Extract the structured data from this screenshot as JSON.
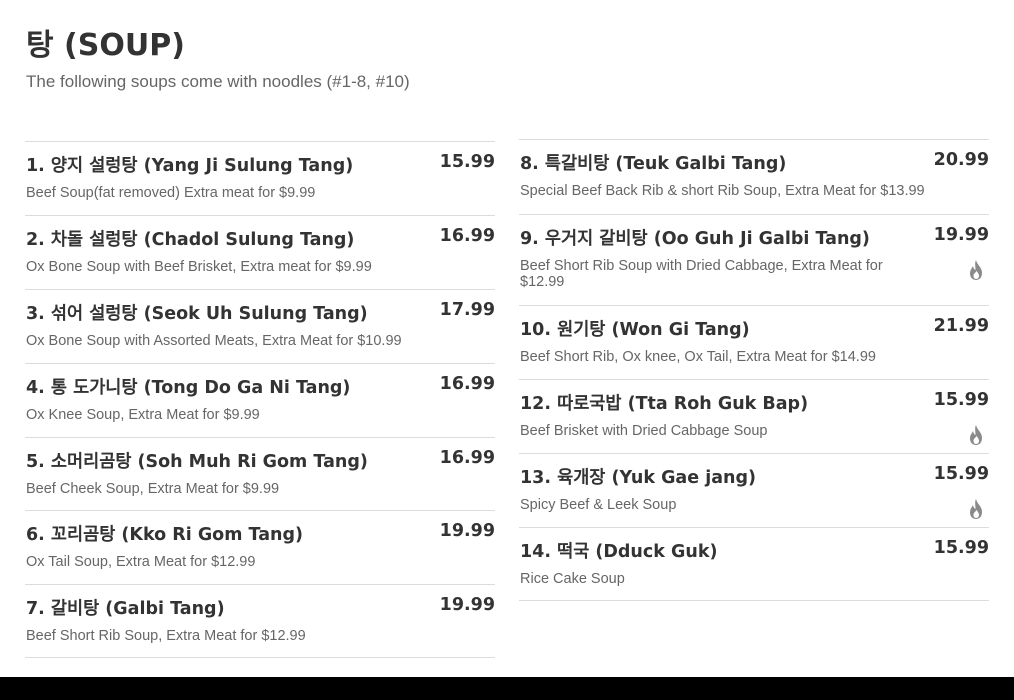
{
  "header": {
    "title": "탕 (SOUP)",
    "subtitle": "The following soups come with noodles (#1-8, #10)"
  },
  "colors": {
    "text": "#333333",
    "muted": "#666666",
    "divider": "#dcdcdc",
    "spicy_icon": "#8a8a8a",
    "bottom_bar": "#000000"
  },
  "left_column": [
    {
      "name": "1. 양지 설렁탕 (Yang Ji Sulung Tang)",
      "price": "15.99",
      "desc": "Beef Soup(fat removed) Extra meat for $9.99",
      "spicy": false
    },
    {
      "name": "2. 차돌 설렁탕 (Chadol Sulung Tang)",
      "price": "16.99",
      "desc": "Ox Bone Soup with Beef Brisket, Extra meat for $9.99",
      "spicy": false
    },
    {
      "name": "3. 섞어 설렁탕 (Seok Uh Sulung Tang)",
      "price": "17.99",
      "desc": "Ox Bone Soup with Assorted Meats, Extra Meat for $10.99",
      "spicy": false
    },
    {
      "name": "4. 통 도가니탕 (Tong Do Ga Ni Tang)",
      "price": "16.99",
      "desc": "Ox Knee Soup, Extra Meat for $9.99",
      "spicy": false
    },
    {
      "name": "5. 소머리곰탕 (Soh Muh Ri Gom Tang)",
      "price": "16.99",
      "desc": "Beef Cheek Soup, Extra Meat for $9.99",
      "spicy": false
    },
    {
      "name": "6. 꼬리곰탕 (Kko Ri Gom Tang)",
      "price": "19.99",
      "desc": "Ox Tail Soup, Extra Meat for $12.99",
      "spicy": false
    },
    {
      "name": "7. 갈비탕 (Galbi Tang)",
      "price": "19.99",
      "desc": "Beef Short Rib Soup, Extra Meat for $12.99",
      "spicy": false
    }
  ],
  "right_column": [
    {
      "name": "8. 특갈비탕 (Teuk Galbi Tang)",
      "price": "20.99",
      "desc": "Special Beef Back Rib & short Rib Soup, Extra Meat for $13.99",
      "spicy": false
    },
    {
      "name": "9. 우거지 갈비탕 (Oo Guh Ji Galbi Tang)",
      "price": "19.99",
      "desc": "Beef Short Rib Soup with Dried Cabbage, Extra Meat for $12.99",
      "spicy": true
    },
    {
      "name": "10. 원기탕 (Won Gi Tang)",
      "price": "21.99",
      "desc": "Beef Short Rib, Ox knee, Ox Tail, Extra Meat for $14.99",
      "spicy": false
    },
    {
      "name": "12. 따로국밥 (Tta Roh Guk Bap)",
      "price": "15.99",
      "desc": "Beef Brisket with Dried Cabbage Soup",
      "spicy": true
    },
    {
      "name": "13. 육개장 (Yuk Gae jang)",
      "price": "15.99",
      "desc": "Spicy Beef & Leek Soup",
      "spicy": true
    },
    {
      "name": "14. 떡국 (Dduck Guk)",
      "price": "15.99",
      "desc": "Rice Cake Soup",
      "spicy": false
    }
  ]
}
